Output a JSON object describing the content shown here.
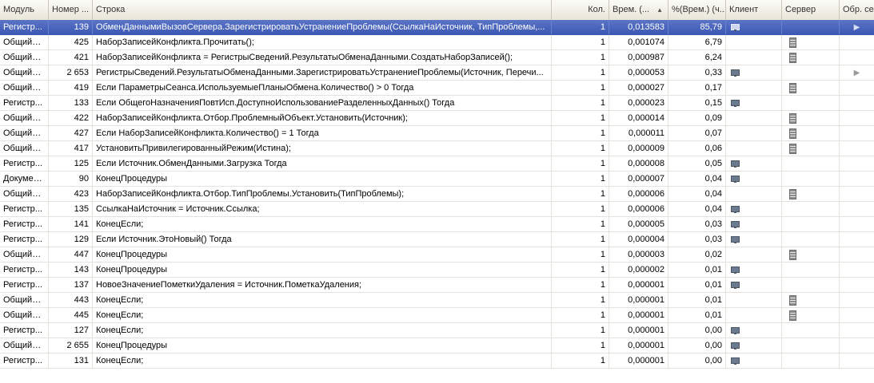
{
  "columns": {
    "module": "Модуль",
    "number": "Номер ...",
    "line": "Строка",
    "count": "Кол.",
    "time": "Врем. (...",
    "percent": "%(Врем.) (ч...",
    "client": "Клиент",
    "server": "Сервер",
    "extra": "Обр. се"
  },
  "icons": {
    "sort": "▲",
    "client": "client-monitor-icon",
    "server": "server-tower-icon",
    "arrow": "▶"
  },
  "rows": [
    {
      "module": "Регистр...",
      "number": "139",
      "line": "ОбменДаннымиВызовСервера.ЗарегистрироватьУстранениеПроблемы(СсылкаНаИсточник, ТипПроблемы,...",
      "count": "1",
      "time": "0,013583",
      "percent": "85,79",
      "client": true,
      "server": false,
      "arrow": true,
      "selected": true
    },
    {
      "module": "ОбщийМ...",
      "number": "425",
      "line": "НаборЗаписейКонфликта.Прочитать();",
      "count": "1",
      "time": "0,001074",
      "percent": "6,79",
      "client": false,
      "server": true,
      "arrow": false
    },
    {
      "module": "ОбщийМ...",
      "number": "421",
      "line": "НаборЗаписейКонфликта = РегистрыСведений.РезультатыОбменаДанными.СоздатьНаборЗаписей();",
      "count": "1",
      "time": "0,000987",
      "percent": "6,24",
      "client": false,
      "server": true,
      "arrow": false
    },
    {
      "module": "ОбщийМ...",
      "number": "2 653",
      "line": "РегистрыСведений.РезультатыОбменаДанными.ЗарегистрироватьУстранениеПроблемы(Источник, Перечи...",
      "count": "1",
      "time": "0,000053",
      "percent": "0,33",
      "client": true,
      "server": false,
      "arrow": true
    },
    {
      "module": "ОбщийМ...",
      "number": "419",
      "line": "Если ПараметрыСеанса.ИспользуемыеПланыОбмена.Количество() > 0 Тогда",
      "count": "1",
      "time": "0,000027",
      "percent": "0,17",
      "client": false,
      "server": true,
      "arrow": false
    },
    {
      "module": "Регистр...",
      "number": "133",
      "line": "Если ОбщегоНазначенияПовтИсп.ДоступноИспользованиеРазделенныхДанных() Тогда",
      "count": "1",
      "time": "0,000023",
      "percent": "0,15",
      "client": true,
      "server": false,
      "arrow": false
    },
    {
      "module": "ОбщийМ...",
      "number": "422",
      "line": "НаборЗаписейКонфликта.Отбор.ПроблемныйОбъект.Установить(Источник);",
      "count": "1",
      "time": "0,000014",
      "percent": "0,09",
      "client": false,
      "server": true,
      "arrow": false
    },
    {
      "module": "ОбщийМ...",
      "number": "427",
      "line": "Если НаборЗаписейКонфликта.Количество() = 1 Тогда",
      "count": "1",
      "time": "0,000011",
      "percent": "0,07",
      "client": false,
      "server": true,
      "arrow": false
    },
    {
      "module": "ОбщийМ...",
      "number": "417",
      "line": "УстановитьПривилегированныйРежим(Истина);",
      "count": "1",
      "time": "0,000009",
      "percent": "0,06",
      "client": false,
      "server": true,
      "arrow": false
    },
    {
      "module": "Регистр...",
      "number": "125",
      "line": "Если Источник.ОбменДанными.Загрузка Тогда",
      "count": "1",
      "time": "0,000008",
      "percent": "0,05",
      "client": true,
      "server": false,
      "arrow": false
    },
    {
      "module": "Докумен...",
      "number": "90",
      "line": "КонецПроцедуры",
      "count": "1",
      "time": "0,000007",
      "percent": "0,04",
      "client": true,
      "server": false,
      "arrow": false
    },
    {
      "module": "ОбщийМ...",
      "number": "423",
      "line": "НаборЗаписейКонфликта.Отбор.ТипПроблемы.Установить(ТипПроблемы);",
      "count": "1",
      "time": "0,000006",
      "percent": "0,04",
      "client": false,
      "server": true,
      "arrow": false
    },
    {
      "module": "Регистр...",
      "number": "135",
      "line": "СсылкаНаИсточник = Источник.Ссылка;",
      "count": "1",
      "time": "0,000006",
      "percent": "0,04",
      "client": true,
      "server": false,
      "arrow": false
    },
    {
      "module": "Регистр...",
      "number": "141",
      "line": "КонецЕсли;",
      "count": "1",
      "time": "0,000005",
      "percent": "0,03",
      "client": true,
      "server": false,
      "arrow": false
    },
    {
      "module": "Регистр...",
      "number": "129",
      "line": "Если Источник.ЭтоНовый() Тогда",
      "count": "1",
      "time": "0,000004",
      "percent": "0,03",
      "client": true,
      "server": false,
      "arrow": false
    },
    {
      "module": "ОбщийМ...",
      "number": "447",
      "line": "КонецПроцедуры",
      "count": "1",
      "time": "0,000003",
      "percent": "0,02",
      "client": false,
      "server": true,
      "arrow": false
    },
    {
      "module": "Регистр...",
      "number": "143",
      "line": "КонецПроцедуры",
      "count": "1",
      "time": "0,000002",
      "percent": "0,01",
      "client": true,
      "server": false,
      "arrow": false
    },
    {
      "module": "Регистр...",
      "number": "137",
      "line": "НовоеЗначениеПометкиУдаления = Источник.ПометкаУдаления;",
      "count": "1",
      "time": "0,000001",
      "percent": "0,01",
      "client": true,
      "server": false,
      "arrow": false
    },
    {
      "module": "ОбщийМ...",
      "number": "443",
      "line": "КонецЕсли;",
      "count": "1",
      "time": "0,000001",
      "percent": "0,01",
      "client": false,
      "server": true,
      "arrow": false
    },
    {
      "module": "ОбщийМ...",
      "number": "445",
      "line": "КонецЕсли;",
      "count": "1",
      "time": "0,000001",
      "percent": "0,01",
      "client": false,
      "server": true,
      "arrow": false
    },
    {
      "module": "Регистр...",
      "number": "127",
      "line": "КонецЕсли;",
      "count": "1",
      "time": "0,000001",
      "percent": "0,00",
      "client": true,
      "server": false,
      "arrow": false
    },
    {
      "module": "ОбщийМ...",
      "number": "2 655",
      "line": "КонецПроцедуры",
      "count": "1",
      "time": "0,000001",
      "percent": "0,00",
      "client": true,
      "server": false,
      "arrow": false
    },
    {
      "module": "Регистр...",
      "number": "131",
      "line": "КонецЕсли;",
      "count": "1",
      "time": "0,000001",
      "percent": "0,00",
      "client": true,
      "server": false,
      "arrow": false
    }
  ]
}
